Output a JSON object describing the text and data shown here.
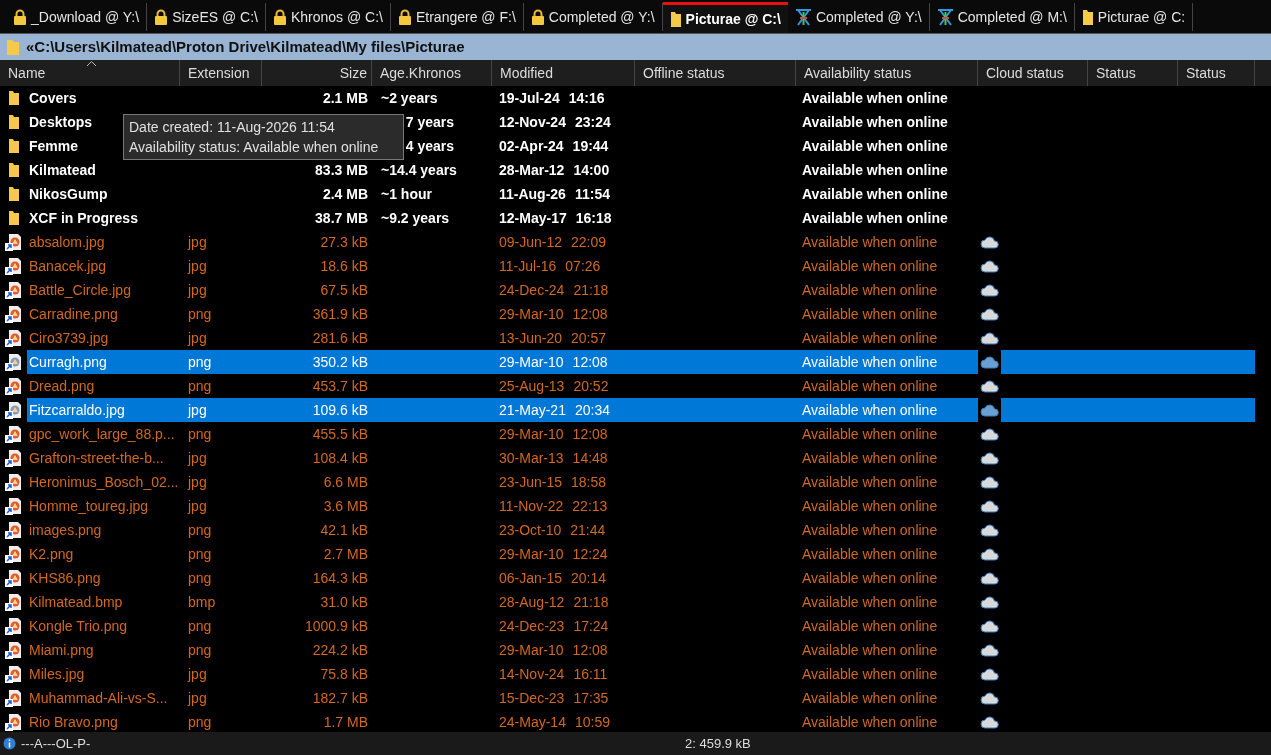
{
  "tabs": [
    {
      "label": "_Download @ Y:\\",
      "kind": "locked",
      "selected": false
    },
    {
      "label": "SizeES @ C:\\",
      "kind": "locked",
      "selected": false
    },
    {
      "label": "Khronos @ C:\\",
      "kind": "locked",
      "selected": false
    },
    {
      "label": "Etrangere @ F:\\",
      "kind": "locked",
      "selected": false
    },
    {
      "label": "Completed @ Y:\\",
      "kind": "locked",
      "selected": false
    },
    {
      "label": "Picturae @ C:\\",
      "kind": "folder",
      "selected": true
    },
    {
      "label": "Completed @ Y:\\",
      "kind": "tool",
      "selected": false
    },
    {
      "label": "Completed @ M:\\",
      "kind": "tool",
      "selected": false
    },
    {
      "label": "Picturae @ C:",
      "kind": "folder",
      "selected": false
    }
  ],
  "path": "«C:\\Users\\Kilmatead\\Proton Drive\\Kilmatead\\My files\\Picturae",
  "columns": [
    "Name",
    "Extension",
    "Size",
    "Age.Khronos",
    "Modified",
    "Offline status",
    "Availability status",
    "Cloud status",
    "Status",
    "Status"
  ],
  "rows": [
    {
      "kind": "folder",
      "name": "Covers",
      "size": "2.1 MB",
      "age": "~2 years",
      "date": "19-Jul-24",
      "time": "14:16",
      "availability": "Available when online",
      "selected": false
    },
    {
      "kind": "folder",
      "name": "Desktops",
      "age": "7 years",
      "date": "12-Nov-24",
      "time": "23:24",
      "availability": "Available when online",
      "selected": false
    },
    {
      "kind": "folder",
      "name": "Femme",
      "age": "4 years",
      "date": "02-Apr-24",
      "time": "19:44",
      "availability": "Available when online",
      "selected": false
    },
    {
      "kind": "folder",
      "name": "Kilmatead",
      "size": "83.3 MB",
      "age": "~14.4 years",
      "date": "28-Mar-12",
      "time": "14:00",
      "availability": "Available when online",
      "selected": false
    },
    {
      "kind": "folder",
      "name": "NikosGump",
      "size": "2.4 MB",
      "age": "~1 hour",
      "date": "11-Aug-26",
      "time": "11:54",
      "availability": "Available when online",
      "selected": false
    },
    {
      "kind": "folder",
      "name": "XCF in Progress",
      "size": "38.7 MB",
      "age": "~9.2 years",
      "date": "12-May-17",
      "time": "16:18",
      "availability": "Available when online",
      "selected": false
    },
    {
      "kind": "file",
      "name": "absalom.jpg",
      "ext": "jpg",
      "size": "27.3 kB",
      "date": "09-Jun-12",
      "time": "22:09",
      "availability": "Available when online",
      "selected": false
    },
    {
      "kind": "file",
      "name": "Banacek.jpg",
      "ext": "jpg",
      "size": "18.6 kB",
      "date": "11-Jul-16",
      "time": "07:26",
      "availability": "Available when online",
      "selected": false
    },
    {
      "kind": "file",
      "name": "Battle_Circle.jpg",
      "ext": "jpg",
      "size": "67.5 kB",
      "date": "24-Dec-24",
      "time": "21:18",
      "availability": "Available when online",
      "selected": false
    },
    {
      "kind": "file",
      "name": "Carradine.png",
      "ext": "png",
      "size": "361.9 kB",
      "date": "29-Mar-10",
      "time": "12:08",
      "availability": "Available when online",
      "selected": false
    },
    {
      "kind": "file",
      "name": "Ciro3739.jpg",
      "ext": "jpg",
      "size": "281.6 kB",
      "date": "13-Jun-20",
      "time": "20:57",
      "availability": "Available when online",
      "selected": false
    },
    {
      "kind": "file",
      "name": "Curragh.png",
      "ext": "png",
      "size": "350.2 kB",
      "date": "29-Mar-10",
      "time": "12:08",
      "availability": "Available when online",
      "selected": true
    },
    {
      "kind": "file",
      "name": "Dread.png",
      "ext": "png",
      "size": "453.7 kB",
      "date": "25-Aug-13",
      "time": "20:52",
      "availability": "Available when online",
      "selected": false
    },
    {
      "kind": "file",
      "name": "Fitzcarraldo.jpg",
      "ext": "jpg",
      "size": "109.6 kB",
      "date": "21-May-21",
      "time": "20:34",
      "availability": "Available when online",
      "selected": true
    },
    {
      "kind": "file",
      "name": "gpc_work_large_88.p...",
      "ext": "png",
      "size": "455.5 kB",
      "date": "29-Mar-10",
      "time": "12:08",
      "availability": "Available when online",
      "selected": false
    },
    {
      "kind": "file",
      "name": "Grafton-street-the-b...",
      "ext": "jpg",
      "size": "108.4 kB",
      "date": "30-Mar-13",
      "time": "14:48",
      "availability": "Available when online",
      "selected": false
    },
    {
      "kind": "file",
      "name": "Heronimus_Bosch_02...",
      "ext": "jpg",
      "size": "6.6 MB",
      "date": "23-Jun-15",
      "time": "18:58",
      "availability": "Available when online",
      "selected": false
    },
    {
      "kind": "file",
      "name": "Homme_toureg.jpg",
      "ext": "jpg",
      "size": "3.6 MB",
      "date": "11-Nov-22",
      "time": "22:13",
      "availability": "Available when online",
      "selected": false
    },
    {
      "kind": "file",
      "name": "images.png",
      "ext": "png",
      "size": "42.1 kB",
      "date": "23-Oct-10",
      "time": "21:44",
      "availability": "Available when online",
      "selected": false
    },
    {
      "kind": "file",
      "name": "K2.png",
      "ext": "png",
      "size": "2.7 MB",
      "date": "29-Mar-10",
      "time": "12:24",
      "availability": "Available when online",
      "selected": false
    },
    {
      "kind": "file",
      "name": "KHS86.png",
      "ext": "png",
      "size": "164.3 kB",
      "date": "06-Jan-15",
      "time": "20:14",
      "availability": "Available when online",
      "selected": false
    },
    {
      "kind": "file",
      "name": "Kilmatead.bmp",
      "ext": "bmp",
      "size": "31.0 kB",
      "date": "28-Aug-12",
      "time": "21:18",
      "availability": "Available when online",
      "selected": false
    },
    {
      "kind": "file",
      "name": "Kongle Trio.png",
      "ext": "png",
      "size": "1000.9 kB",
      "date": "24-Dec-23",
      "time": "17:24",
      "availability": "Available when online",
      "selected": false
    },
    {
      "kind": "file",
      "name": "Miami.png",
      "ext": "png",
      "size": "224.2 kB",
      "date": "29-Mar-10",
      "time": "12:08",
      "availability": "Available when online",
      "selected": false
    },
    {
      "kind": "file",
      "name": "Miles.jpg",
      "ext": "jpg",
      "size": "75.8 kB",
      "date": "14-Nov-24",
      "time": "16:11",
      "availability": "Available when online",
      "selected": false
    },
    {
      "kind": "file",
      "name": "Muhammad-Ali-vs-S...",
      "ext": "jpg",
      "size": "182.7 kB",
      "date": "15-Dec-23",
      "time": "17:35",
      "availability": "Available when online",
      "selected": false
    },
    {
      "kind": "file",
      "name": "Rio Bravo.png",
      "ext": "png",
      "size": "1.7 MB",
      "date": "24-May-14",
      "time": "10:59",
      "availability": "Available when online",
      "selected": false
    }
  ],
  "tooltip": [
    "Date created: 11-Aug-2026 11:54",
    "Availability status: Available when online"
  ],
  "status_bar": {
    "attributes": "---A---OL-P-",
    "selection": "2: 459.9 kB"
  }
}
